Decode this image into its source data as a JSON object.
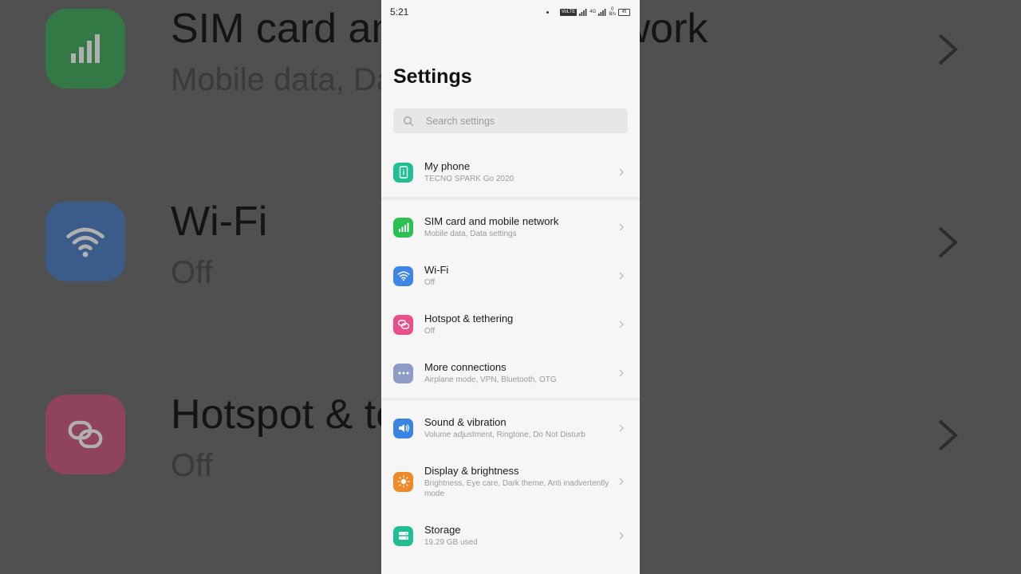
{
  "status": {
    "time": "5:21",
    "volte": "VoLTE",
    "network": "4G",
    "speed_value": "0",
    "speed_unit": "B/s",
    "battery": "45"
  },
  "page": {
    "title": "Settings"
  },
  "search": {
    "placeholder": "Search settings"
  },
  "items": [
    {
      "title": "My phone",
      "subtitle": "TECNO SPARK Go 2020",
      "icon": "info-icon",
      "color": "#1fbf93"
    },
    {
      "title": "SIM card and mobile network",
      "subtitle": "Mobile data, Data settings",
      "icon": "signal-icon",
      "color": "#2bc152"
    },
    {
      "title": "Wi-Fi",
      "subtitle": "Off",
      "icon": "wifi-icon",
      "color": "#3d86e6"
    },
    {
      "title": "Hotspot & tethering",
      "subtitle": "Off",
      "icon": "link-icon",
      "color": "#ea4f8a"
    },
    {
      "title": "More connections",
      "subtitle": "Airplane mode, VPN, Bluetooth, OTG",
      "icon": "more-icon",
      "color": "#8c9cc6"
    },
    {
      "title": "Sound & vibration",
      "subtitle": "Volume adjustment, Ringtone, Do Not Disturb",
      "icon": "speaker-icon",
      "color": "#3a84e4"
    },
    {
      "title": "Display & brightness",
      "subtitle": "Brightness, Eye care, Dark theme, Anti inadvertently mode",
      "icon": "sun-icon",
      "color": "#f08a28"
    },
    {
      "title": "Storage",
      "subtitle": "19.29 GB used",
      "icon": "storage-icon",
      "color": "#1fbf93"
    }
  ],
  "background": {
    "rows": [
      {
        "title": "SIM card and mobile network",
        "subtitle": "Mobile data, Data settings",
        "color": "#1d9b3d"
      },
      {
        "title": "Wi-Fi",
        "subtitle": "Off",
        "color": "#2a66b8"
      },
      {
        "title": "Hotspot & tethering",
        "subtitle": "Off",
        "color": "#c33966"
      }
    ]
  }
}
